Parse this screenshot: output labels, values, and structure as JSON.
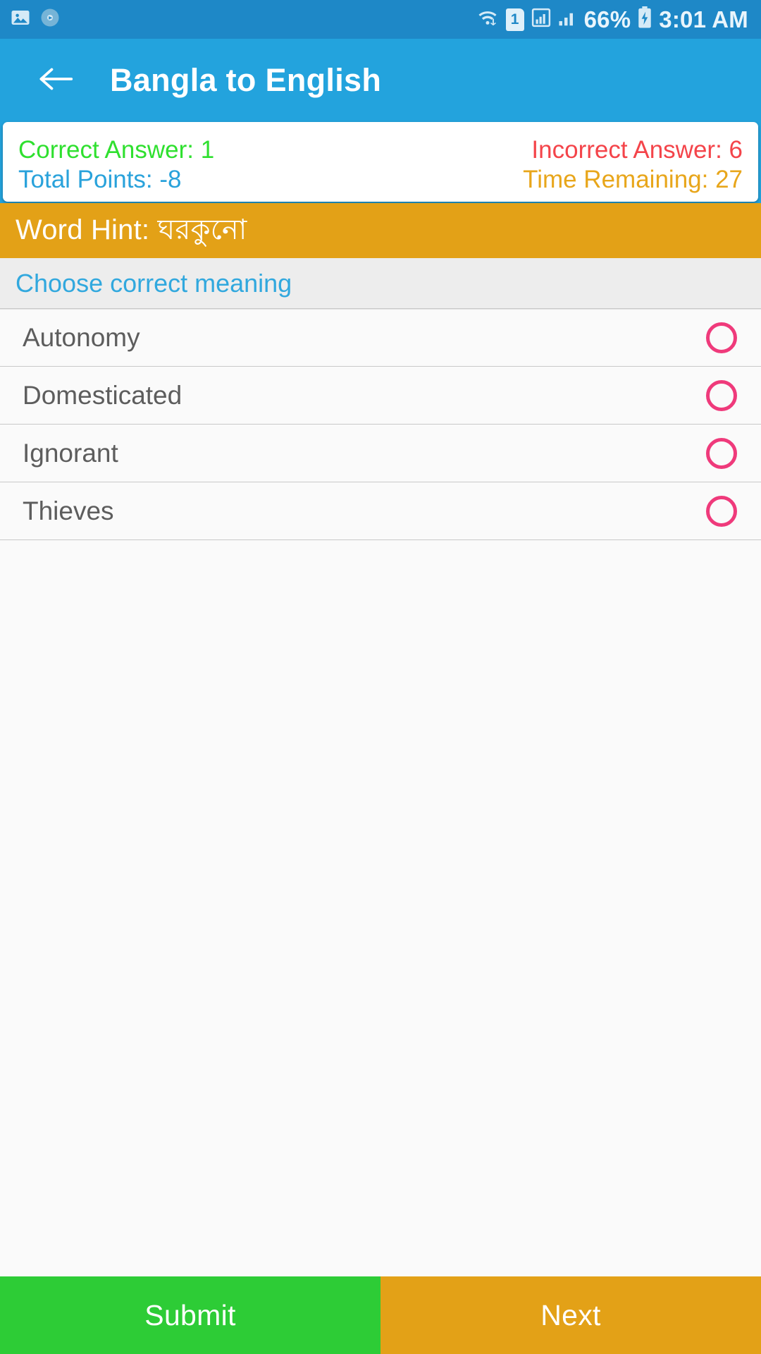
{
  "status_bar": {
    "left_icons": [
      "image-icon",
      "media-disc-icon"
    ],
    "wifi_icon": "wifi-transfer-icon",
    "sim_label": "1",
    "signal_icons": [
      "signal-bars-boxed-icon",
      "signal-bars-icon"
    ],
    "battery_percent": "66%",
    "battery_icon": "battery-charging-icon",
    "time": "3:01 AM"
  },
  "appbar": {
    "back_icon": "back-arrow-icon",
    "title": "Bangla to English"
  },
  "score_card": {
    "correct": "Correct Answer: 1",
    "incorrect": "Incorrect Answer: 6",
    "points": "Total Points: -8",
    "time_remaining": "Time Remaining: 27"
  },
  "word_hint": {
    "text": "Word Hint: ঘরকুনো"
  },
  "prompt": {
    "text": "Choose correct meaning"
  },
  "options": [
    {
      "label": "Autonomy",
      "selected": false
    },
    {
      "label": "Domesticated",
      "selected": false
    },
    {
      "label": "Ignorant",
      "selected": false
    },
    {
      "label": "Thieves",
      "selected": false
    }
  ],
  "bottom_bar": {
    "submit_label": "Submit",
    "next_label": "Next"
  },
  "colors": {
    "status_bar": "#1E88C7",
    "app_bar": "#23A3DD",
    "accent_blue": "#29A2DB",
    "correct_green": "#2FE02F",
    "incorrect_red": "#F4444A",
    "orange": "#E3A117",
    "radio_pink": "#EF3A7B",
    "submit_green": "#2DCC36",
    "page_background": "#FAFAFA",
    "band_background": "#EDEDED"
  }
}
